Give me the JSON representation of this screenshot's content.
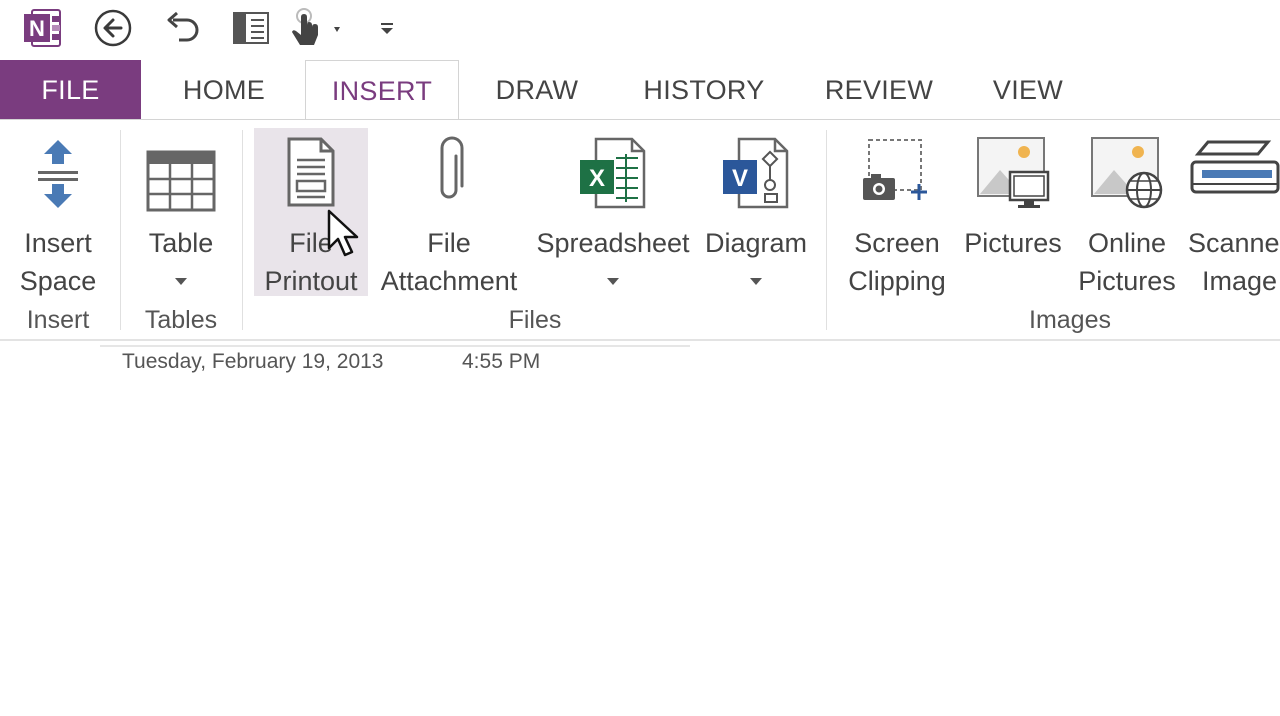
{
  "quick_access": {
    "icons": [
      "onenote-logo-icon",
      "back-icon",
      "undo-icon",
      "dock-to-desktop-icon",
      "touch-mode-icon",
      "customize-qat-icon"
    ]
  },
  "tabs": [
    {
      "label": "FILE"
    },
    {
      "label": "HOME"
    },
    {
      "label": "INSERT"
    },
    {
      "label": "DRAW"
    },
    {
      "label": "HISTORY"
    },
    {
      "label": "REVIEW"
    },
    {
      "label": "VIEW"
    }
  ],
  "active_tab": "INSERT",
  "ribbon": {
    "groups": {
      "insert": "Insert",
      "tables": "Tables",
      "files": "Files",
      "images": "Images"
    },
    "buttons": {
      "insert_space": {
        "line1": "Insert",
        "line2": "Space"
      },
      "table": {
        "line1": "Table"
      },
      "file_printout": {
        "line1": "File",
        "line2": "Printout"
      },
      "file_attachment": {
        "line1": "File",
        "line2": "Attachment"
      },
      "spreadsheet": {
        "line1": "Spreadsheet"
      },
      "diagram": {
        "line1": "Diagram"
      },
      "screen_clipping": {
        "line1": "Screen",
        "line2": "Clipping"
      },
      "pictures": {
        "line1": "Pictures"
      },
      "online_pictures": {
        "line1": "Online",
        "line2": "Pictures"
      },
      "scanned_image": {
        "line1": "Scanne",
        "line2": "Image"
      }
    }
  },
  "page": {
    "date": "Tuesday, February 19, 2013",
    "time": "4:55 PM"
  },
  "colors": {
    "accent": "#7a3c7f",
    "excel_green": "#1e7145",
    "visio_blue": "#2b579a",
    "hover_bg": "#e9e4ea"
  }
}
